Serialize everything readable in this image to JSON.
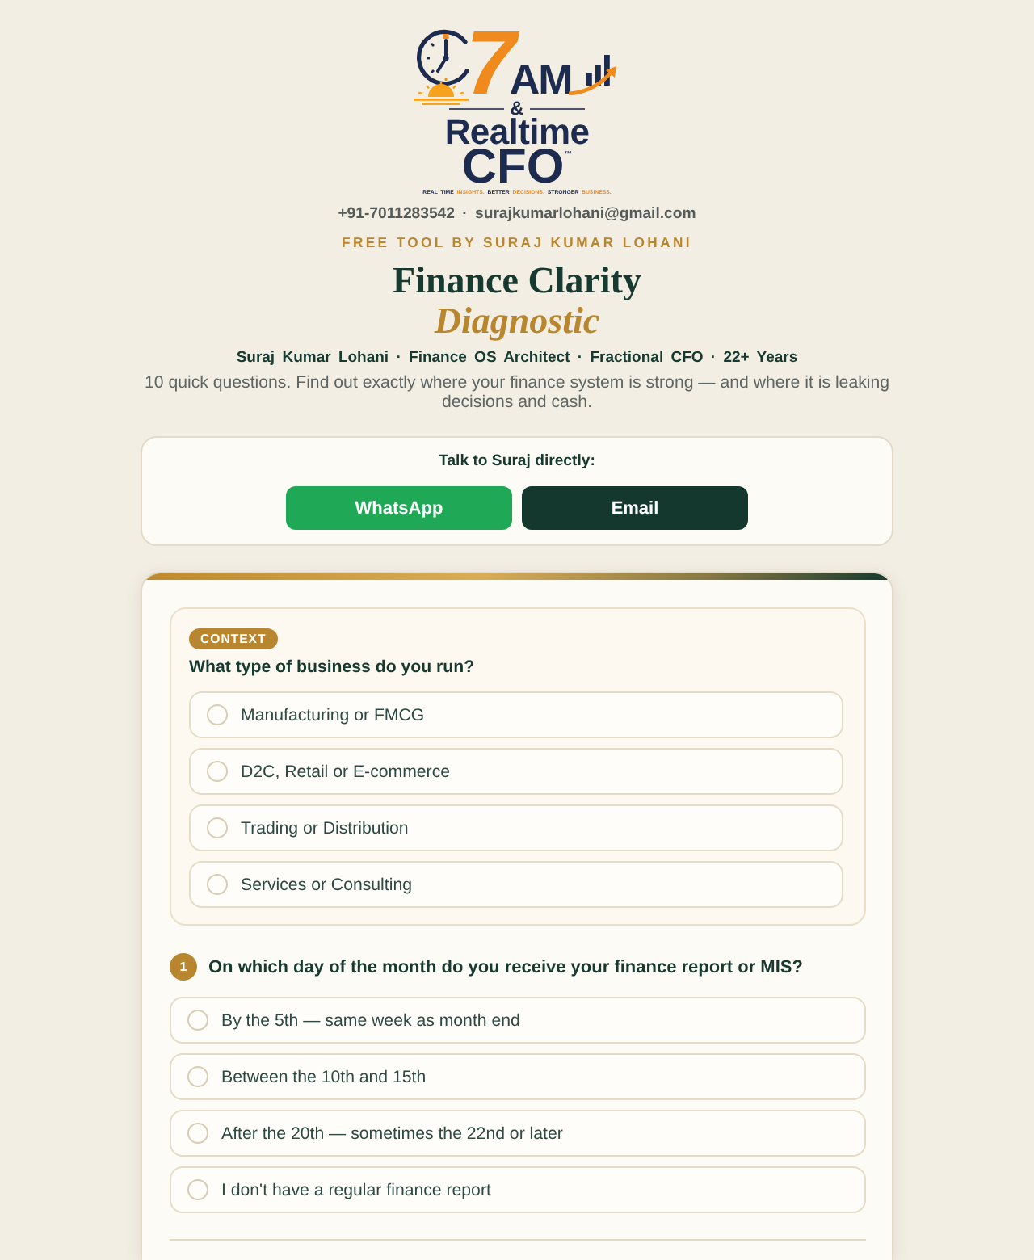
{
  "logo": {
    "numeral": "7",
    "suffix": "AM",
    "ampersand": "&",
    "line_1": "Realtime",
    "line_2": "CFO",
    "trademark": "™",
    "tagline": [
      {
        "text": "REAL TIME",
        "accent": false
      },
      {
        "text": "INSIGHTS.",
        "accent": true
      },
      {
        "text": "BETTER",
        "accent": false
      },
      {
        "text": "DECISIONS.",
        "accent": true
      },
      {
        "text": "STRONGER",
        "accent": false
      },
      {
        "text": "BUSINESS.",
        "accent": true
      }
    ]
  },
  "contact_line": "+91-7011283542 · surajkumarlohani@gmail.com",
  "eyebrow": "FREE TOOL BY SURAJ KUMAR LOHANI",
  "title": "Finance Clarity",
  "subtitle": "Diagnostic",
  "byline": "Suraj Kumar Lohani · Finance OS Architect · Fractional CFO · 22+ Years",
  "intro": "10 quick questions. Find out exactly where your finance system is strong — and where it is leaking decisions and cash.",
  "contact_card": {
    "prompt": "Talk to Suraj directly:",
    "buttons": [
      {
        "label": "WhatsApp",
        "kind": "whatsapp"
      },
      {
        "label": "Email",
        "kind": "email"
      }
    ]
  },
  "quiz": {
    "context": {
      "badge": "CONTEXT",
      "question": "What type of business do you run?",
      "options": [
        {
          "label": "Manufacturing or FMCG",
          "selected": false
        },
        {
          "label": "D2C, Retail or E-commerce",
          "selected": false
        },
        {
          "label": "Trading or Distribution",
          "selected": false
        },
        {
          "label": "Services or Consulting",
          "selected": false
        }
      ]
    },
    "questions": [
      {
        "number": "1",
        "text": "On which day of the month do you receive your finance report or MIS?",
        "options": [
          {
            "label": "By the 5th — same week as month end",
            "selected": false
          },
          {
            "label": "Between the 10th and 15th",
            "selected": false
          },
          {
            "label": "After the 20th — sometimes the 22nd or later",
            "selected": false
          },
          {
            "label": "I don't have a regular finance report",
            "selected": false
          }
        ]
      }
    ]
  }
}
